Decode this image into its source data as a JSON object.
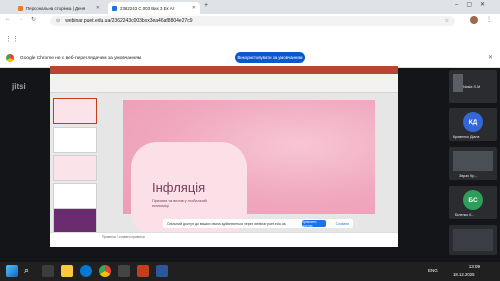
{
  "browser": {
    "tabs": [
      {
        "title": "Персональна сторінка | Деня"
      },
      {
        "title": "2362243 С 003 Вих 3 Ек Ат"
      }
    ],
    "url": "webinar.puet.edu.ua/2362243c003bxx3ea46af8804e27c9",
    "infobar_text": "Google Chrome не є веб-переглядачем за умовчанням",
    "infobar_button": "Використовувати за умовчанням"
  },
  "meeting": {
    "logo": "jitsi",
    "participants": [
      {
        "initials": "",
        "name": "Nasia S-M",
        "color": "#3b3f45"
      },
      {
        "initials": "КД",
        "name": "Кривенко Діана",
        "color": "#3367d6"
      },
      {
        "initials": "",
        "name": "Зврах Кр...",
        "color": "#4a4f55"
      },
      {
        "initials": "БС",
        "name": "Біленко К...",
        "color": "#2e9e5b"
      },
      {
        "initials": "",
        "name": "",
        "color": "#3b3f45"
      }
    ]
  },
  "presentation": {
    "slide_title": "Інфляція",
    "slide_subtitle": "Причини та вплив у глобальній економіці",
    "status_note": "Примітки / сховати примітки",
    "share_notice": "Спільний доступ до вашого вікна здійснюється через webinar.puet.edu.ua",
    "stop_share": "Зупинити доступ",
    "hide": "Сховати"
  },
  "taskbar": {
    "time": "13:09",
    "date": "18.12.2025",
    "lang": "ENG"
  }
}
